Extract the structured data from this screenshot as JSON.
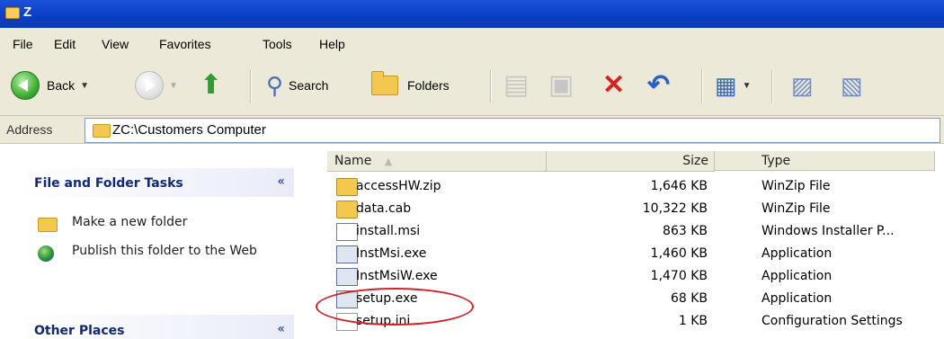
{
  "window": {
    "title": "Z"
  },
  "menu": [
    "File",
    "Edit",
    "View",
    "Favorites",
    "Tools",
    "Help"
  ],
  "toolbar": {
    "back_label": "Back",
    "search_label": "Search",
    "folders_label": "Folders"
  },
  "address": {
    "label": "Address",
    "value": "ZC:\\Customers Computer"
  },
  "tasks": {
    "file_folder_tasks": {
      "title": "File and Folder Tasks",
      "items": [
        "Make a new folder",
        "Publish this folder to the Web"
      ]
    },
    "other_places": {
      "title": "Other Places"
    },
    "collapse_glyph": "«"
  },
  "columns": {
    "name": "Name",
    "size": "Size",
    "type": "Type"
  },
  "files": [
    {
      "name": "accessHW.zip",
      "size": "1,646 KB",
      "type": "WinZip File",
      "icon": "zip-file-icon"
    },
    {
      "name": "data.cab",
      "size": "10,322 KB",
      "type": "WinZip File",
      "icon": "cab-file-icon"
    },
    {
      "name": "install.msi",
      "size": "863 KB",
      "type": "Windows Installer P...",
      "icon": "msi-file-icon"
    },
    {
      "name": "InstMsi.exe",
      "size": "1,460 KB",
      "type": "Application",
      "icon": "exe-file-icon"
    },
    {
      "name": "InstMsiW.exe",
      "size": "1,470 KB",
      "type": "Application",
      "icon": "exe-file-icon"
    },
    {
      "name": "setup.exe",
      "size": "68 KB",
      "type": "Application",
      "icon": "setup-exe-icon"
    },
    {
      "name": "setup.ini",
      "size": "1 KB",
      "type": "Configuration Settings",
      "icon": "ini-file-icon"
    }
  ],
  "colors": {
    "titlebar": "#0a3ec4",
    "chrome": "#ece9d8",
    "highlight": "#d4202a"
  }
}
